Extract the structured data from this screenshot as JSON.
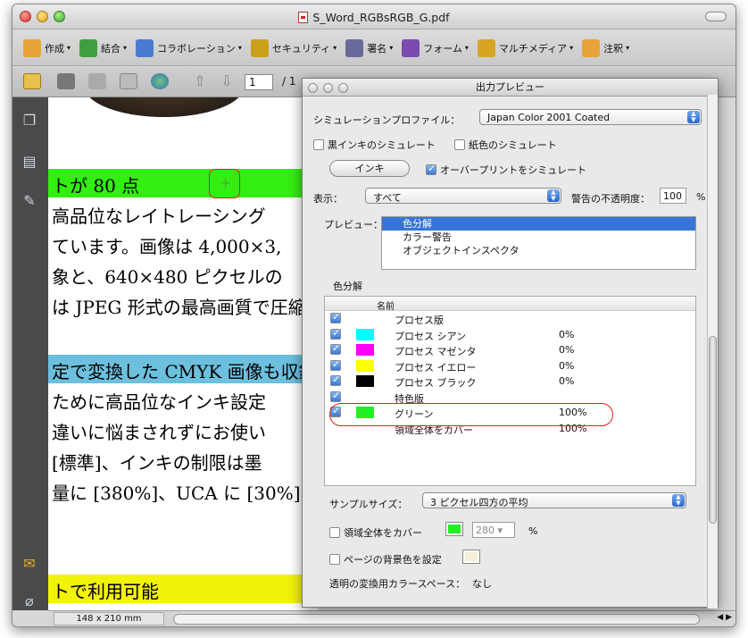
{
  "window": {
    "title": "S_Word_RGBsRGB_G.pdf"
  },
  "toolbar": {
    "items": [
      {
        "label": "作成",
        "icon": "create-icon",
        "color": "#e8a23a"
      },
      {
        "label": "結合",
        "icon": "combine-icon",
        "color": "#3f9e3f"
      },
      {
        "label": "コラボレーション",
        "icon": "collaboration-icon",
        "color": "#4a7bd0"
      },
      {
        "label": "セキュリティ",
        "icon": "lock-icon",
        "color": "#c9a01a"
      },
      {
        "label": "署名",
        "icon": "pen-icon",
        "color": "#6a6a9a"
      },
      {
        "label": "フォーム",
        "icon": "form-icon",
        "color": "#7b4bb0"
      },
      {
        "label": "マルチメディア",
        "icon": "multimedia-icon",
        "color": "#d6a623"
      },
      {
        "label": "注釈",
        "icon": "comment-icon",
        "color": "#e8a23a"
      }
    ],
    "page_current": "1",
    "page_total": "/ 1"
  },
  "document": {
    "lines": [
      "トが 80 点",
      "高品位なレイトレーシング",
      "ています。画像は 4,000×3,",
      "象と、640×480 ピクセルの",
      "は JPEG 形式の最高画質で圧縮",
      "定で変換した CMYK 画像も収録",
      "ために高品位なインキ設定",
      "違いに悩まされずにお使い",
      "[標準]、インキの制限は墨",
      "量に [380%]、UCA に [30%]",
      "トで利用可能"
    ],
    "page_size": "148 x 210 mm",
    "band_colors": {
      "green": "#33ee11",
      "blue": "#6cc0de",
      "yellow": "#f2f20a"
    }
  },
  "preview_panel": {
    "title": "出力プレビュー",
    "sim_profile_label": "シミュレーションプロファイル：",
    "sim_profile_value": "Japan Color 2001 Coated",
    "black_ink_label": "黒インキのシミュレート",
    "black_ink_checked": false,
    "paper_color_label": "紙色のシミュレート",
    "paper_color_checked": false,
    "ink_button": "インキ",
    "overprint_label": "オーバープリントをシミュレート",
    "overprint_checked": true,
    "show_label": "表示：",
    "show_value": "すべて",
    "opacity_label": "警告の不透明度：",
    "opacity_value": "100",
    "opacity_unit": "%",
    "preview_label": "プレビュー：",
    "preview_options": [
      "色分解",
      "カラー警告",
      "オブジェクトインスペクタ"
    ],
    "preview_selected": "色分解",
    "separations_group_label": "色分解",
    "separations_header": "名前",
    "separations": [
      {
        "name": "プロセス版",
        "color": "",
        "pct": "",
        "checked": true
      },
      {
        "name": "プロセス シアン",
        "color": "#00ffff",
        "pct": "0%",
        "checked": true
      },
      {
        "name": "プロセス マゼンタ",
        "color": "#ff00ff",
        "pct": "0%",
        "checked": true
      },
      {
        "name": "プロセス イエロー",
        "color": "#ffff00",
        "pct": "0%",
        "checked": true
      },
      {
        "name": "プロセス ブラック",
        "color": "#000000",
        "pct": "0%",
        "checked": true
      },
      {
        "name": "特色版",
        "color": "",
        "pct": "",
        "checked": true
      },
      {
        "name": "グリーン",
        "color": "#22ee22",
        "pct": "100%",
        "checked": true
      },
      {
        "name": "領域全体をカバー",
        "color": "",
        "pct": "100%",
        "checked": false
      }
    ],
    "sample_size_label": "サンプルサイズ：",
    "sample_size_value": "3 ピクセル四方の平均",
    "cover_label": "領域全体をカバー",
    "cover_checked": false,
    "cover_color": "#22ee22",
    "cover_value": "280",
    "cover_unit": "%",
    "page_bg_label": "ページの背景色を設定",
    "page_bg_checked": false,
    "page_bg_color": "#f3efd9",
    "transparency_label": "透明の変換用カラースペース：",
    "transparency_value": "なし"
  }
}
